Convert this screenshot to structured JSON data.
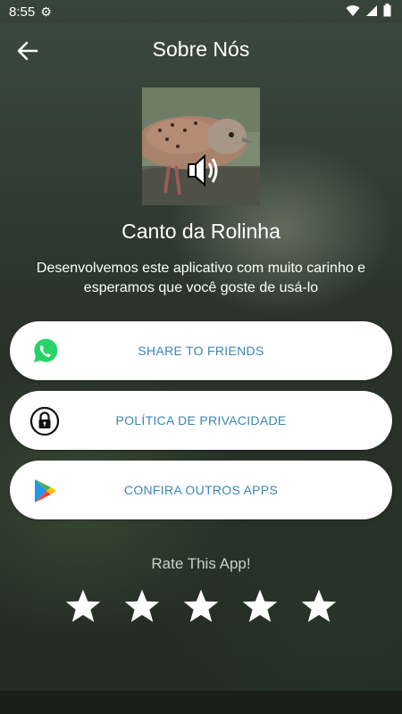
{
  "status_bar": {
    "time": "8:55"
  },
  "header": {
    "title": "Sobre Nós"
  },
  "app": {
    "name": "Canto da Rolinha",
    "description": "Desenvolvemos este aplicativo com muito carinho e esperamos que você goste de usá-lo"
  },
  "buttons": [
    {
      "label": "SHARE TO FRIENDS",
      "icon": "whatsapp-icon"
    },
    {
      "label": "POLÍTICA DE PRIVACIDADE",
      "icon": "lock-icon"
    },
    {
      "label": "CONFIRA OUTROS APPS",
      "icon": "google-play-icon"
    }
  ],
  "rating": {
    "label": "Rate This App!",
    "max_stars": 5,
    "selected": 0
  },
  "colors": {
    "accent": "#3b86b4",
    "whatsapp": "#25D366",
    "card": "#ffffff"
  }
}
